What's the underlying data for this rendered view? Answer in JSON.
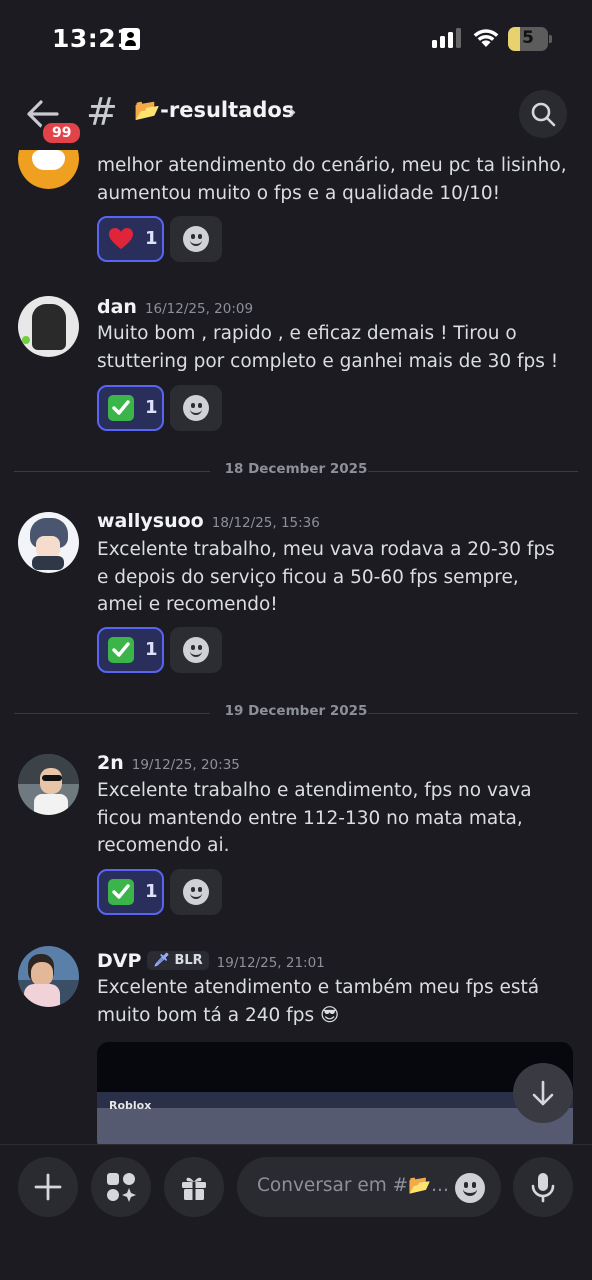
{
  "status_bar": {
    "time": "13:21",
    "battery": "5"
  },
  "header": {
    "unread_count": "99",
    "channel_name": "📂-resultados"
  },
  "messages": [
    {
      "id": "msg-top",
      "content": "melhor atendimento do cenário, meu pc ta lisinho, aumentou muito o fps e a qualidade 10/10!",
      "reaction": {
        "emoji": "heart",
        "count": "1"
      }
    },
    {
      "id": "msg-dan",
      "author": "dan",
      "timestamp": "16/12/25, 20:09",
      "content": "Muito bom , rapido , e eficaz demais ! Tirou o stuttering por completo e ganhei mais de 30 fps !",
      "reaction": {
        "emoji": "check-mark",
        "count": "1"
      }
    },
    {
      "id": "msg-wallysuoo",
      "author": "wallysuoo",
      "timestamp": "18/12/25, 15:36",
      "content": "Excelente trabalho, meu vava rodava a 20-30 fps e depois do serviço ficou a 50-60 fps sempre, amei e recomendo!",
      "reaction": {
        "emoji": "check-mark",
        "count": "1"
      }
    },
    {
      "id": "msg-2n",
      "author": "2n",
      "timestamp": "19/12/25, 20:35",
      "content": "Excelente trabalho e atendimento, fps no vava ficou mantendo entre 112-130 no mata mata, recomendo ai.",
      "reaction": {
        "emoji": "check-mark",
        "count": "1"
      }
    },
    {
      "id": "msg-dvp",
      "author": "DVP",
      "tag": "BLR",
      "timestamp": "19/12/25, 21:01",
      "content": "Excelente atendimento e também meu fps está muito bom tá a 240 fps 😎",
      "attachment_label": "Roblox"
    }
  ],
  "dividers": [
    "18 December 2025",
    "19 December 2025"
  ],
  "composer": {
    "placeholder": "Conversar em #📂..."
  },
  "colors": {
    "background": "#1b1b21",
    "reaction_active_bg": "#2a2e5a",
    "reaction_active_border": "#5865f2",
    "badge_red": "#e2424a"
  }
}
